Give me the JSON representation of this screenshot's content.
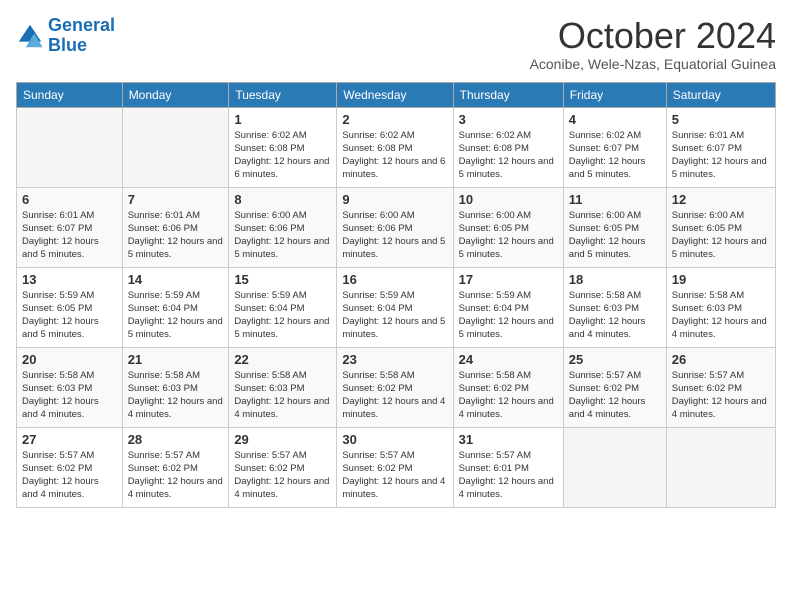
{
  "header": {
    "logo_line1": "General",
    "logo_line2": "Blue",
    "month": "October 2024",
    "location": "Aconibe, Wele-Nzas, Equatorial Guinea"
  },
  "weekdays": [
    "Sunday",
    "Monday",
    "Tuesday",
    "Wednesday",
    "Thursday",
    "Friday",
    "Saturday"
  ],
  "weeks": [
    [
      {
        "day": "",
        "info": ""
      },
      {
        "day": "",
        "info": ""
      },
      {
        "day": "1",
        "info": "Sunrise: 6:02 AM\nSunset: 6:08 PM\nDaylight: 12 hours and 6 minutes."
      },
      {
        "day": "2",
        "info": "Sunrise: 6:02 AM\nSunset: 6:08 PM\nDaylight: 12 hours and 6 minutes."
      },
      {
        "day": "3",
        "info": "Sunrise: 6:02 AM\nSunset: 6:08 PM\nDaylight: 12 hours and 5 minutes."
      },
      {
        "day": "4",
        "info": "Sunrise: 6:02 AM\nSunset: 6:07 PM\nDaylight: 12 hours and 5 minutes."
      },
      {
        "day": "5",
        "info": "Sunrise: 6:01 AM\nSunset: 6:07 PM\nDaylight: 12 hours and 5 minutes."
      }
    ],
    [
      {
        "day": "6",
        "info": "Sunrise: 6:01 AM\nSunset: 6:07 PM\nDaylight: 12 hours and 5 minutes."
      },
      {
        "day": "7",
        "info": "Sunrise: 6:01 AM\nSunset: 6:06 PM\nDaylight: 12 hours and 5 minutes."
      },
      {
        "day": "8",
        "info": "Sunrise: 6:00 AM\nSunset: 6:06 PM\nDaylight: 12 hours and 5 minutes."
      },
      {
        "day": "9",
        "info": "Sunrise: 6:00 AM\nSunset: 6:06 PM\nDaylight: 12 hours and 5 minutes."
      },
      {
        "day": "10",
        "info": "Sunrise: 6:00 AM\nSunset: 6:05 PM\nDaylight: 12 hours and 5 minutes."
      },
      {
        "day": "11",
        "info": "Sunrise: 6:00 AM\nSunset: 6:05 PM\nDaylight: 12 hours and 5 minutes."
      },
      {
        "day": "12",
        "info": "Sunrise: 6:00 AM\nSunset: 6:05 PM\nDaylight: 12 hours and 5 minutes."
      }
    ],
    [
      {
        "day": "13",
        "info": "Sunrise: 5:59 AM\nSunset: 6:05 PM\nDaylight: 12 hours and 5 minutes."
      },
      {
        "day": "14",
        "info": "Sunrise: 5:59 AM\nSunset: 6:04 PM\nDaylight: 12 hours and 5 minutes."
      },
      {
        "day": "15",
        "info": "Sunrise: 5:59 AM\nSunset: 6:04 PM\nDaylight: 12 hours and 5 minutes."
      },
      {
        "day": "16",
        "info": "Sunrise: 5:59 AM\nSunset: 6:04 PM\nDaylight: 12 hours and 5 minutes."
      },
      {
        "day": "17",
        "info": "Sunrise: 5:59 AM\nSunset: 6:04 PM\nDaylight: 12 hours and 5 minutes."
      },
      {
        "day": "18",
        "info": "Sunrise: 5:58 AM\nSunset: 6:03 PM\nDaylight: 12 hours and 4 minutes."
      },
      {
        "day": "19",
        "info": "Sunrise: 5:58 AM\nSunset: 6:03 PM\nDaylight: 12 hours and 4 minutes."
      }
    ],
    [
      {
        "day": "20",
        "info": "Sunrise: 5:58 AM\nSunset: 6:03 PM\nDaylight: 12 hours and 4 minutes."
      },
      {
        "day": "21",
        "info": "Sunrise: 5:58 AM\nSunset: 6:03 PM\nDaylight: 12 hours and 4 minutes."
      },
      {
        "day": "22",
        "info": "Sunrise: 5:58 AM\nSunset: 6:03 PM\nDaylight: 12 hours and 4 minutes."
      },
      {
        "day": "23",
        "info": "Sunrise: 5:58 AM\nSunset: 6:02 PM\nDaylight: 12 hours and 4 minutes."
      },
      {
        "day": "24",
        "info": "Sunrise: 5:58 AM\nSunset: 6:02 PM\nDaylight: 12 hours and 4 minutes."
      },
      {
        "day": "25",
        "info": "Sunrise: 5:57 AM\nSunset: 6:02 PM\nDaylight: 12 hours and 4 minutes."
      },
      {
        "day": "26",
        "info": "Sunrise: 5:57 AM\nSunset: 6:02 PM\nDaylight: 12 hours and 4 minutes."
      }
    ],
    [
      {
        "day": "27",
        "info": "Sunrise: 5:57 AM\nSunset: 6:02 PM\nDaylight: 12 hours and 4 minutes."
      },
      {
        "day": "28",
        "info": "Sunrise: 5:57 AM\nSunset: 6:02 PM\nDaylight: 12 hours and 4 minutes."
      },
      {
        "day": "29",
        "info": "Sunrise: 5:57 AM\nSunset: 6:02 PM\nDaylight: 12 hours and 4 minutes."
      },
      {
        "day": "30",
        "info": "Sunrise: 5:57 AM\nSunset: 6:02 PM\nDaylight: 12 hours and 4 minutes."
      },
      {
        "day": "31",
        "info": "Sunrise: 5:57 AM\nSunset: 6:01 PM\nDaylight: 12 hours and 4 minutes."
      },
      {
        "day": "",
        "info": ""
      },
      {
        "day": "",
        "info": ""
      }
    ]
  ]
}
